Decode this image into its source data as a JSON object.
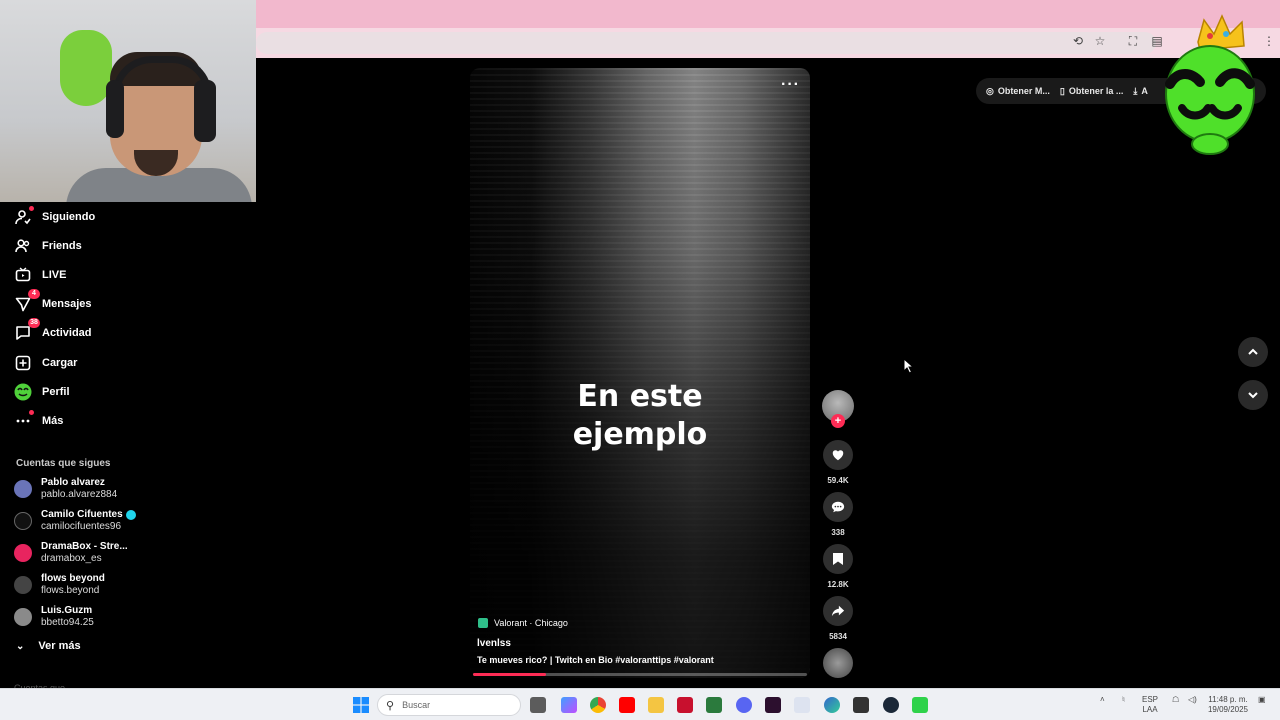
{
  "nav": {
    "items": [
      {
        "label": "Siguiendo",
        "icon": "following-icon"
      },
      {
        "label": "Friends",
        "icon": "friends-icon"
      },
      {
        "label": "LIVE",
        "icon": "live-icon"
      },
      {
        "label": "Mensajes",
        "icon": "messages-icon",
        "badge": "4"
      },
      {
        "label": "Actividad",
        "icon": "activity-icon",
        "badge": "38"
      },
      {
        "label": "Cargar",
        "icon": "upload-icon"
      },
      {
        "label": "Perfil",
        "icon": "profile-icon"
      },
      {
        "label": "Más",
        "icon": "more-icon"
      }
    ]
  },
  "following": {
    "heading": "Cuentas que sigues",
    "accounts": [
      {
        "name": "Pablo alvarez",
        "user": "pablo.alvarez884",
        "color": "#6a74b8"
      },
      {
        "name": "Camilo Cifuentes",
        "user": "camilocifuentes96",
        "color": "#111111",
        "verified": true
      },
      {
        "name": "DramaBox - Stre...",
        "user": "dramabox_es",
        "color": "#e8245f"
      },
      {
        "name": "flows beyond",
        "user": "flows.beyond",
        "color": "#444444"
      },
      {
        "name": "Luis.Guzm",
        "user": "bbetto94.25",
        "color": "#8a8a8a"
      }
    ],
    "see_more": "Ver más",
    "cutoff_text": "Cuentas que..."
  },
  "video": {
    "caption_line1": "En este",
    "caption_line2": "ejemplo",
    "tag": "Valorant · Chicago",
    "author": "lvenlss",
    "description": "Te mueves rico? | Twitch en Bio #valoranttips  #valorant",
    "progress": 0.22,
    "more": "···"
  },
  "actions": {
    "likes": "59.4K",
    "comments": "338",
    "saves": "12.8K",
    "shares": "5834"
  },
  "topbar": {
    "item1": "Obtener M...",
    "item2": "Obtener la ...",
    "item3": "A"
  },
  "taskbar": {
    "search_placeholder": "Buscar",
    "lang1": "ESP",
    "lang2": "LAA",
    "time": "11:48 p. m.",
    "date": "19/09/2025"
  },
  "colors": {
    "accent": "#fe2c55",
    "tab_bar": "#f2b8cd",
    "background": "#000000"
  }
}
